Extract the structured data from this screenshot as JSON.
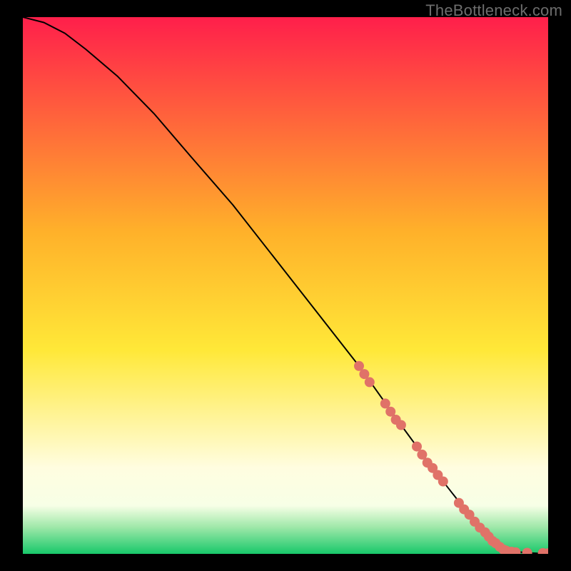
{
  "watermark": "TheBottleneck.com",
  "colors": {
    "gradient_top": "#ff1f4b",
    "gradient_upper_mid": "#ffb12a",
    "gradient_mid": "#ffe838",
    "gradient_lower_mid": "#fffde0",
    "gradient_bottom_band_top": "#f7ffe6",
    "gradient_bottom_band_mid": "#9fe8a9",
    "gradient_bottom": "#18c86a",
    "curve": "#000000",
    "marker": "#e07268",
    "frame": "#000000"
  },
  "chart_data": {
    "type": "line",
    "title": "",
    "xlabel": "",
    "ylabel": "",
    "xlim": [
      0,
      100
    ],
    "ylim": [
      0,
      100
    ],
    "series": [
      {
        "name": "curve",
        "x": [
          0,
          4,
          8,
          12,
          18,
          25,
          32,
          40,
          48,
          56,
          64,
          72,
          78,
          82,
          86,
          88,
          90,
          92,
          94,
          96,
          98,
          100
        ],
        "y": [
          100,
          99,
          97,
          94,
          89,
          82,
          74,
          65,
          55,
          45,
          35,
          24,
          16,
          11,
          6,
          4,
          2,
          1,
          0.4,
          0.2,
          0.1,
          0.1
        ]
      }
    ],
    "markers": {
      "name": "highlighted-segment",
      "points": [
        {
          "x": 64,
          "y": 35
        },
        {
          "x": 65,
          "y": 33.5
        },
        {
          "x": 66,
          "y": 32
        },
        {
          "x": 69,
          "y": 28
        },
        {
          "x": 70,
          "y": 26.5
        },
        {
          "x": 71,
          "y": 25
        },
        {
          "x": 72,
          "y": 24
        },
        {
          "x": 75,
          "y": 20
        },
        {
          "x": 76,
          "y": 18.5
        },
        {
          "x": 77,
          "y": 17
        },
        {
          "x": 78,
          "y": 16
        },
        {
          "x": 79,
          "y": 14.7
        },
        {
          "x": 80,
          "y": 13.5
        },
        {
          "x": 83,
          "y": 9.5
        },
        {
          "x": 84,
          "y": 8.3
        },
        {
          "x": 85,
          "y": 7.3
        },
        {
          "x": 86,
          "y": 6
        },
        {
          "x": 87,
          "y": 4.9
        },
        {
          "x": 88,
          "y": 4
        },
        {
          "x": 88.7,
          "y": 3.2
        },
        {
          "x": 89.4,
          "y": 2.4
        },
        {
          "x": 90,
          "y": 2
        },
        {
          "x": 90.8,
          "y": 1.3
        },
        {
          "x": 91.5,
          "y": 0.8
        },
        {
          "x": 92,
          "y": 0.6
        },
        {
          "x": 93,
          "y": 0.4
        },
        {
          "x": 93.8,
          "y": 0.3
        },
        {
          "x": 96,
          "y": 0.2
        },
        {
          "x": 99,
          "y": 0.15
        },
        {
          "x": 100,
          "y": 0.12
        }
      ]
    }
  }
}
